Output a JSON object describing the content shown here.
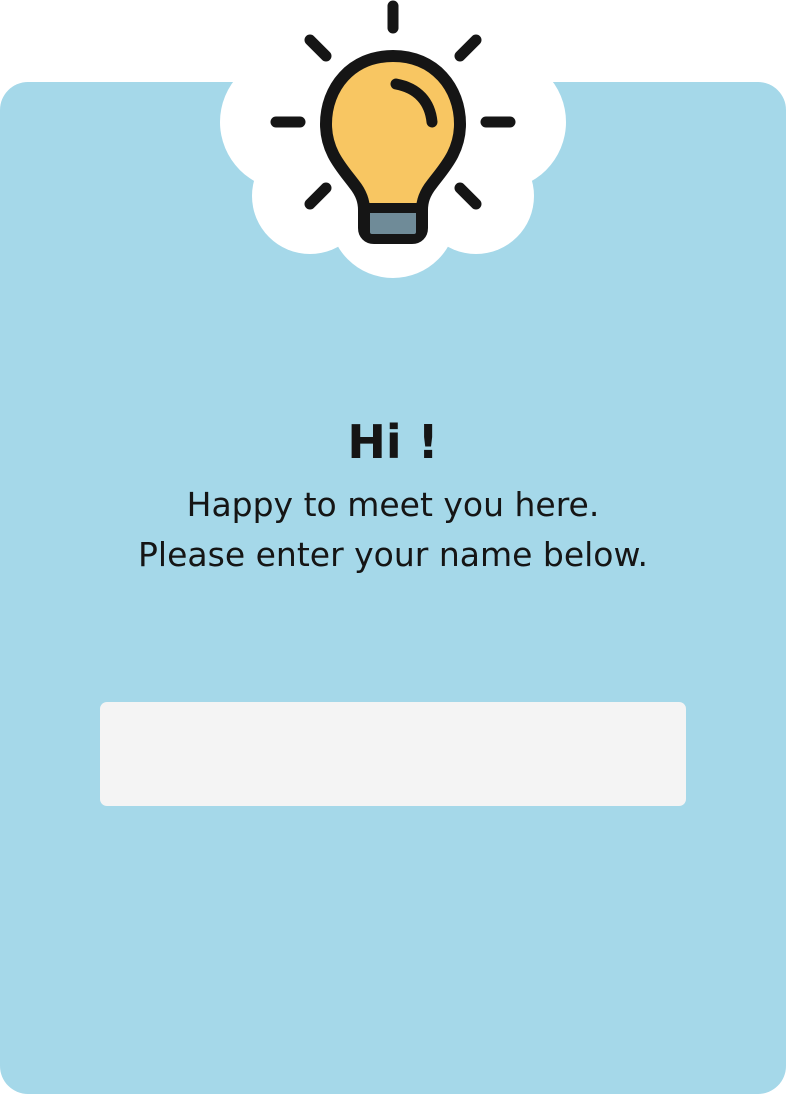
{
  "greeting": {
    "title": "Hi !",
    "line1": "Happy to meet you here.",
    "line2": "Please enter your name below."
  },
  "name_field": {
    "value": "",
    "placeholder": ""
  },
  "icon": {
    "name": "lightbulb-icon"
  },
  "colors": {
    "card_background": "#a5d8e9",
    "input_background": "#f4f4f4",
    "bulb_fill": "#f8c662",
    "bulb_outline": "#151515",
    "bulb_base": "#6f8b98",
    "badge_background": "#ffffff"
  }
}
